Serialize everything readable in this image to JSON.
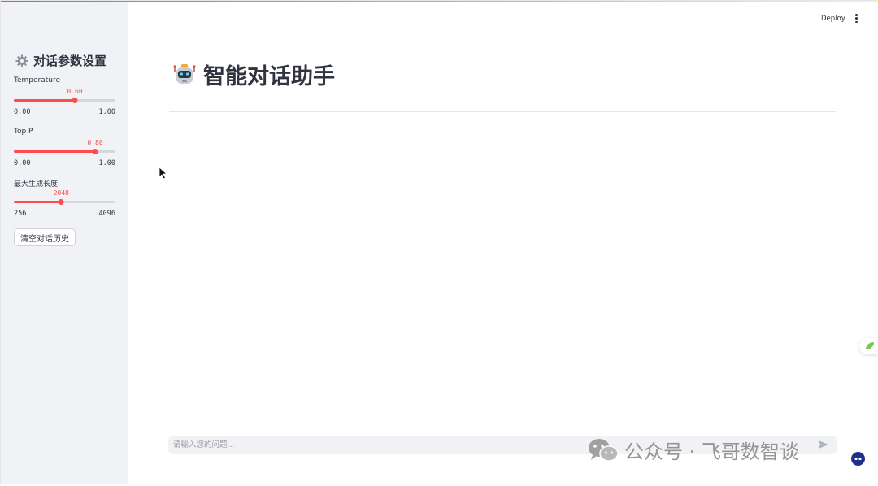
{
  "header": {
    "deploy_label": "Deploy"
  },
  "sidebar": {
    "title": "对话参数设置",
    "sliders": [
      {
        "label": "Temperature",
        "value_text": "0.60",
        "min_text": "0.00",
        "max_text": "1.00",
        "fraction": 0.6
      },
      {
        "label": "Top P",
        "value_text": "0.80",
        "min_text": "0.00",
        "max_text": "1.00",
        "fraction": 0.8
      },
      {
        "label": "最大生成长度",
        "value_text": "2048",
        "min_text": "256",
        "max_text": "4096",
        "fraction": 0.4667
      }
    ],
    "clear_button": "清空对话历史"
  },
  "main": {
    "title": "智能对话助手",
    "chat_placeholder": "请输入您的问题..."
  },
  "watermark": {
    "text": "公众号 · 飞哥数智谈"
  },
  "colors": {
    "accent": "#ff4b4b",
    "sidebar_bg": "#f0f2f6",
    "text": "#31333f"
  }
}
